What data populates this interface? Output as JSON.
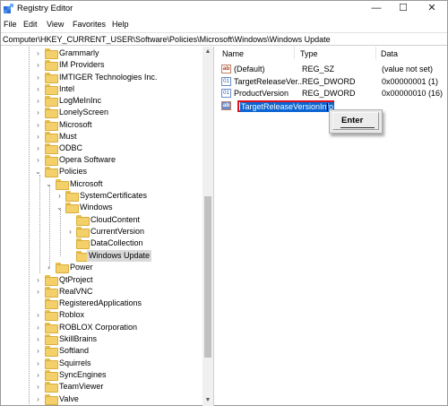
{
  "window": {
    "title": "Registry Editor",
    "controls": {
      "minimize": "—",
      "maximize": "☐",
      "close": "✕"
    }
  },
  "menu": [
    "File",
    "Edit",
    "View",
    "Favorites",
    "Help"
  ],
  "address": "Computer\\HKEY_CURRENT_USER\\Software\\Policies\\Microsoft\\Windows\\Windows Update",
  "tree": [
    {
      "label": "Grammarly",
      "expander": "›"
    },
    {
      "label": "IM Providers",
      "expander": "›"
    },
    {
      "label": "IMTIGER Technologies Inc.",
      "expander": "›"
    },
    {
      "label": "Intel",
      "expander": "›"
    },
    {
      "label": "LogMeInInc",
      "expander": "›"
    },
    {
      "label": "LonelyScreen",
      "expander": "›"
    },
    {
      "label": "Microsoft",
      "expander": "›"
    },
    {
      "label": "Must",
      "expander": "›"
    },
    {
      "label": "ODBC",
      "expander": "›"
    },
    {
      "label": "Opera Software",
      "expander": "›"
    },
    {
      "label": "Policies",
      "expander": "⌄"
    },
    {
      "label": "Microsoft",
      "expander": "⌄"
    },
    {
      "label": "SystemCertificates",
      "expander": "›"
    },
    {
      "label": "Windows",
      "expander": "⌄"
    },
    {
      "label": "CloudContent",
      "expander": ""
    },
    {
      "label": "CurrentVersion",
      "expander": "›"
    },
    {
      "label": "DataCollection",
      "expander": ""
    },
    {
      "label": "Windows Update",
      "expander": ""
    },
    {
      "label": "Power",
      "expander": "›"
    },
    {
      "label": "QtProject",
      "expander": "›"
    },
    {
      "label": "RealVNC",
      "expander": "›"
    },
    {
      "label": "RegisteredApplications",
      "expander": ""
    },
    {
      "label": "Roblox",
      "expander": "›"
    },
    {
      "label": "ROBLOX Corporation",
      "expander": "›"
    },
    {
      "label": "SkillBrains",
      "expander": "›"
    },
    {
      "label": "Softland",
      "expander": "›"
    },
    {
      "label": "Squirrels",
      "expander": "›"
    },
    {
      "label": "SyncEngines",
      "expander": "›"
    },
    {
      "label": "TeamViewer",
      "expander": "›"
    },
    {
      "label": "Valve",
      "expander": "›"
    }
  ],
  "values": {
    "headers": {
      "name": "Name",
      "type": "Type",
      "data": "Data"
    },
    "rows": [
      {
        "icon": "ab",
        "name": "(Default)",
        "type": "REG_SZ",
        "data": "(value not set)"
      },
      {
        "icon": "01",
        "name": "TargetReleaseVer...",
        "type": "REG_DWORD",
        "data": "0x00000001 (1)"
      },
      {
        "icon": "01",
        "name": "ProductVersion",
        "type": "REG_DWORD",
        "data": "0x00000010 (16)"
      }
    ],
    "editing": {
      "icon": "ab",
      "name": "TargetReleaseVersionInfo"
    }
  },
  "enter_key": "Enter",
  "scrollbar": {
    "up": "▲",
    "down": "▼"
  }
}
